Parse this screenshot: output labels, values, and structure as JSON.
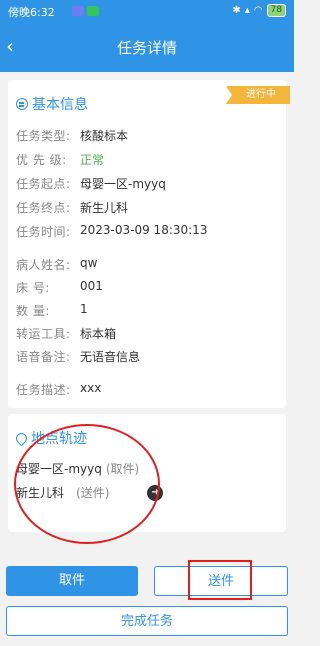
{
  "status_bar": {
    "time": "傍晚6:32",
    "battery": "78"
  },
  "nav": {
    "back_icon": "chevron-left-icon",
    "title": "任务详情"
  },
  "info": {
    "badge": "进行中",
    "section_title": "基本信息",
    "rows": [
      {
        "label": "任务类型:",
        "value": "核酸标本"
      },
      {
        "label": "优 先 级:",
        "value": "正常"
      },
      {
        "label": "任务起点:",
        "value": "母婴一区-myyq"
      },
      {
        "label": "任务终点:",
        "value": "新生儿科"
      },
      {
        "label": "任务时间:",
        "value": "2023-03-09 18:30:13"
      },
      {
        "label": "病人姓名:",
        "value": "qw"
      },
      {
        "label": "床    号:",
        "value": "001"
      },
      {
        "label": "数    量:",
        "value": "1"
      },
      {
        "label": "转运工具:",
        "value": "标本箱"
      },
      {
        "label": "语音备注:",
        "value": "无语音信息"
      },
      {
        "label": "任务描述:",
        "value": "xxx"
      }
    ],
    "priority_color": "#4caf50"
  },
  "location": {
    "section_title": "地点轨迹",
    "items": [
      {
        "name": "母婴一区-myyq",
        "tag": "(取件)"
      },
      {
        "name": "新生儿科",
        "tag": "(送件)"
      }
    ]
  },
  "buttons": {
    "cancel": "取件",
    "send": "送件",
    "complete": "完成任务"
  },
  "colors": {
    "primary": "#2f93e6",
    "badge": "#f4b63a",
    "annotation": "#e02020"
  }
}
